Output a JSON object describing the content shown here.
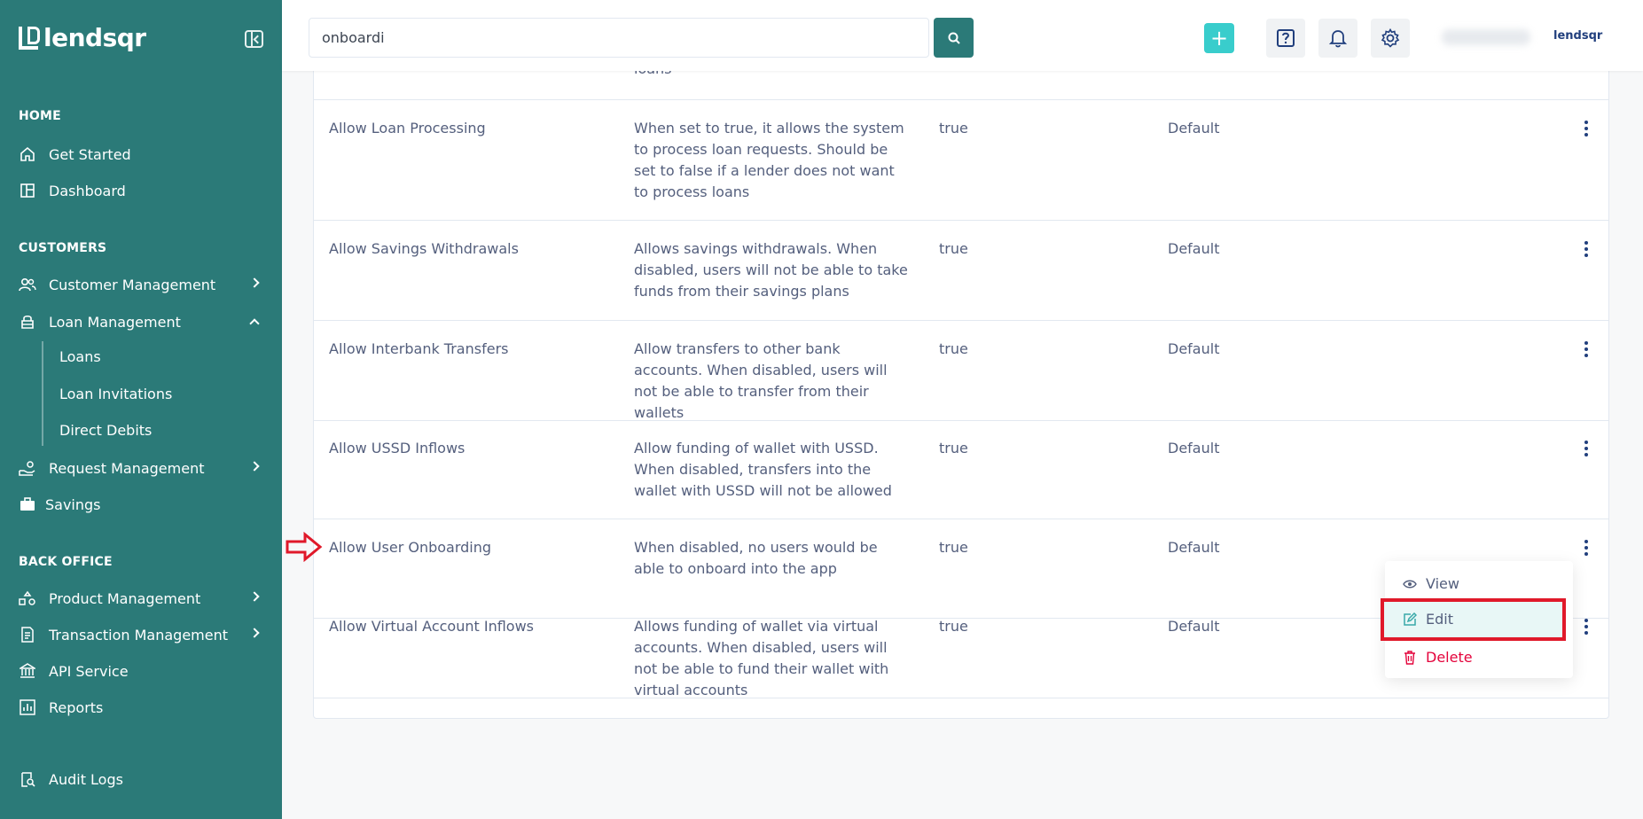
{
  "brand": {
    "name": "lendsqr",
    "small": "lendsqr"
  },
  "sidebar": {
    "sections": {
      "home": "HOME",
      "customers": "CUSTOMERS",
      "back_office": "BACK OFFICE"
    },
    "items": {
      "get_started": "Get Started",
      "dashboard": "Dashboard",
      "customer_management": "Customer Management",
      "loan_management": "Loan Management",
      "loans": "Loans",
      "loan_invitations": "Loan Invitations",
      "direct_debits": "Direct Debits",
      "request_management": "Request Management",
      "savings": "Savings",
      "product_management": "Product Management",
      "transaction_management": "Transaction Management",
      "api_service": "API Service",
      "reports": "Reports",
      "audit_logs": "Audit Logs"
    }
  },
  "header": {
    "search_value": "onboardi"
  },
  "table": {
    "top_fragment": "loans",
    "rows": [
      {
        "name": "Allow Loan Processing",
        "description": "When set to true, it allows the system to process loan requests. Should be set to false if a lender does not want to process loans",
        "value": "true",
        "type": "Default"
      },
      {
        "name": "Allow Savings Withdrawals",
        "description": "Allows savings withdrawals. When disabled, users will not be able to take funds from their savings plans",
        "value": "true",
        "type": "Default"
      },
      {
        "name": "Allow Interbank Transfers",
        "description": "Allow transfers to other bank accounts. When disabled, users will not be able to transfer from their wallets",
        "value": "true",
        "type": "Default"
      },
      {
        "name": "Allow USSD Inflows",
        "description": "Allow funding of wallet with USSD. When disabled, transfers into the wallet with USSD will not be allowed",
        "value": "true",
        "type": "Default"
      },
      {
        "name": "Allow User Onboarding",
        "description": "When disabled, no users would be able to onboard into the app",
        "value": "true",
        "type": "Default"
      },
      {
        "name": "Allow Virtual Account Inflows",
        "description": "Allows funding of wallet via virtual accounts. When disabled, users will not be able to fund their wallet with virtual accounts",
        "value": "true",
        "type": "Default"
      }
    ]
  },
  "menu": {
    "view": "View",
    "edit": "Edit",
    "delete": "Delete"
  },
  "colors": {
    "sidebar": "#2b7a78",
    "accent": "#39cdcc",
    "danger": "#e4033b",
    "highlight": "#e0192a"
  }
}
